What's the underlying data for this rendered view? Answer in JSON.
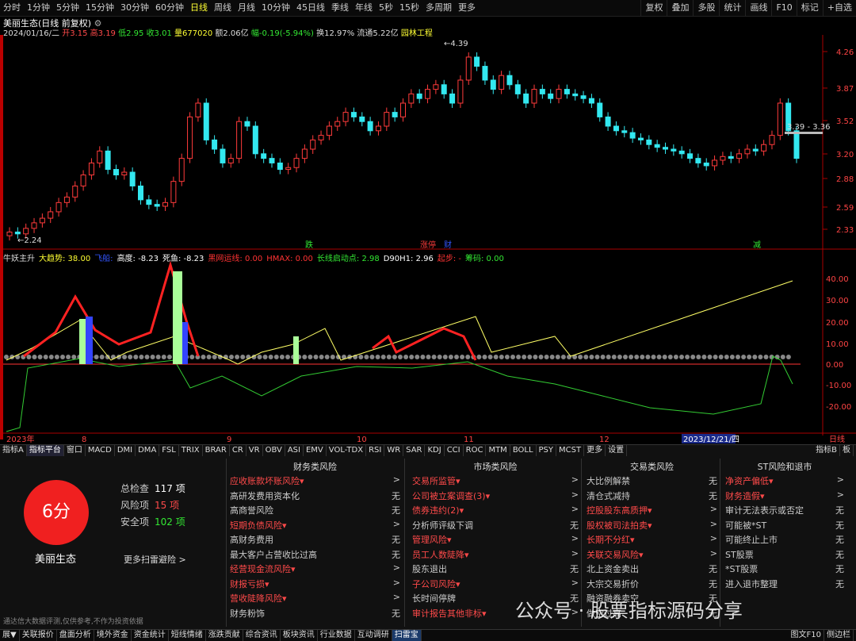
{
  "periods": [
    "分时",
    "1分钟",
    "5分钟",
    "15分钟",
    "30分钟",
    "60分钟",
    "日线",
    "周线",
    "月线",
    "10分钟",
    "45日线",
    "季线",
    "年线",
    "5秒",
    "15秒",
    "多周期",
    "更多"
  ],
  "period_active": "日线",
  "toolbar": [
    "复权",
    "叠加",
    "多股",
    "统计",
    "画线",
    "F10",
    "标记",
    "+自选"
  ],
  "stock": {
    "title": "美丽生态(日线 前复权)",
    "date": "2024/01/16/二",
    "open": "开3.15",
    "high": "高3.19",
    "low": "低2.95",
    "close": "收3.01",
    "vol": "量677020",
    "amt": "额2.06亿",
    "chg": "幅-0.19(-5.94%)",
    "turn": "换12.97%",
    "float": "流通5.22亿",
    "sector": "园林工程"
  },
  "price_axis": [
    "4.26",
    "3.87",
    "3.52",
    "3.20",
    "2.88",
    "2.59",
    "2.33"
  ],
  "price_marks": {
    "high": "4.39",
    "low": "2.24",
    "range": "3.39 - 3.36"
  },
  "event_tags": [
    "跌",
    "涨停",
    "财",
    "减"
  ],
  "indicator": {
    "name": "牛妖主升",
    "items": [
      "大趋势: 38.00",
      "飞船:",
      "高度: -8.23",
      "死鱼: -8.23",
      "黑网运线: 0.00",
      "HMAX: 0.00",
      "长线启动点: 2.98",
      "D90H1: 2.96",
      "起步: -",
      "筹码: 0.00"
    ]
  },
  "ind_axis": [
    "40.00",
    "30.00",
    "20.00",
    "10.00",
    "0.00",
    "-10.00",
    "-20.00"
  ],
  "time_axis": [
    "2023年",
    "8",
    "9",
    "10",
    "11",
    "12",
    "2023/12/21/四",
    "日线"
  ],
  "tabs": [
    "指标A",
    "指标平台",
    "窗口",
    "MACD",
    "DMI",
    "DMA",
    "FSL",
    "TRIX",
    "BRAR",
    "CR",
    "VR",
    "OBV",
    "ASI",
    "EMV",
    "VOL-TDX",
    "RSI",
    "WR",
    "SAR",
    "KDJ",
    "CCI",
    "ROC",
    "MTM",
    "BOLL",
    "PSY",
    "MCST",
    "更多",
    "设置"
  ],
  "tabs_right": [
    "指标B",
    "板"
  ],
  "risk": {
    "score": "6分",
    "total_label": "总检查",
    "total": "117 项",
    "risk_label": "风险项",
    "risk_count": "15 项",
    "safe_label": "安全项",
    "safe_count": "102 项",
    "name": "美丽生态",
    "more": "更多扫雷避险 >",
    "disclaimer": "通达信大数据评测,仅供参考,不作为投资依据",
    "columns": [
      {
        "title": "财务类风险",
        "rows": [
          [
            "应收账款坏账风险▾",
            ">"
          ],
          [
            "高研发费用资本化",
            "无"
          ],
          [
            "高商誉风险",
            "无"
          ],
          [
            "短期负债风险▾",
            ">"
          ],
          [
            "高财务费用",
            "无"
          ],
          [
            "最大客户占营收比过高",
            "无"
          ],
          [
            "经营现金流风险▾",
            ">"
          ],
          [
            "财报亏损▾",
            ">"
          ],
          [
            "营收陡降风险▾",
            ">"
          ],
          [
            "财务粉饰",
            "无"
          ]
        ]
      },
      {
        "title": "市场类风险",
        "rows": [
          [
            "交易所监管▾",
            ">"
          ],
          [
            "公司被立案调查(3)▾",
            ">"
          ],
          [
            "债券违约(2)▾",
            ">"
          ],
          [
            "分析师评级下调",
            "无"
          ],
          [
            "管理风险▾",
            ">"
          ],
          [
            "员工人数陡降▾",
            ">"
          ],
          [
            "股东退出",
            "无"
          ],
          [
            "子公司风险▾",
            ">"
          ],
          [
            "长时间停牌",
            "无"
          ],
          [
            "审计报告其他非标▾",
            ">"
          ]
        ]
      },
      {
        "title": "交易类风险",
        "rows": [
          [
            "大比例解禁",
            "无"
          ],
          [
            "清仓式减持",
            "无"
          ],
          [
            "控股股东高质押▾",
            ">"
          ],
          [
            "股权被司法拍卖▾",
            ">"
          ],
          [
            "长期不分红▾",
            ">"
          ],
          [
            "关联交易风险▾",
            ">"
          ],
          [
            "北上资金卖出",
            "无"
          ],
          [
            "大宗交易折价",
            "无"
          ],
          [
            "融资融券卖空",
            "无"
          ],
          [
            "做空过高",
            "无"
          ]
        ]
      },
      {
        "title": "ST风险和退市",
        "rows": [
          [
            "净资产偏低▾",
            ">"
          ],
          [
            "财务造假▾",
            ">"
          ],
          [
            "审计无法表示或否定",
            "无"
          ],
          [
            "可能被*ST",
            "无"
          ],
          [
            "可能终止上市",
            "无"
          ],
          [
            "ST股票",
            "无"
          ],
          [
            "*ST股票",
            "无"
          ],
          [
            "进入退市整理",
            "无"
          ]
        ]
      }
    ]
  },
  "watermark": "公众号 · 股票指标源码分享",
  "bottom": [
    "展▼",
    "关联报价",
    "盘面分析",
    "境外资金",
    "资金统计",
    "短线情绪",
    "涨跌贡献",
    "综合资讯",
    "板块资讯",
    "行业数据",
    "互动调研",
    "扫雷宝"
  ],
  "bottom_active": "扫雷宝",
  "bottom_right": [
    "图文F10",
    "侧边栏"
  ],
  "colors": {
    "up": "#ff3b3b",
    "down": "#33e8f0",
    "bg": "#000000",
    "accent": "#ffff33"
  }
}
